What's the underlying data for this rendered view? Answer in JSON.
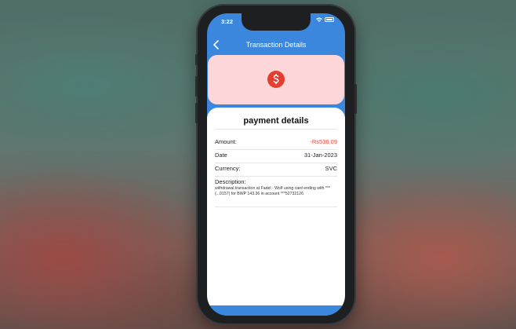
{
  "status_bar": {
    "time": "3:22"
  },
  "nav": {
    "title": "Transaction Details"
  },
  "hero": {
    "background": "#fcd6d8",
    "icon": "dollar-icon",
    "icon_color": "#e53e2f"
  },
  "details": {
    "title": "payment details",
    "amount_label": "Amount:",
    "amount_value": "-Rs536.09",
    "date_label": "Date",
    "date_value": "31-Jan-2023",
    "currency_label": "Currency:",
    "currency_value": "SVC",
    "description_label": "Description:",
    "description_text": "withdrawal transaction at Fadel - Wolf using card ending with ***(...0157) for BWP 143.36 in account ***52732126"
  },
  "colors": {
    "accent": "#3b87dd",
    "negative": "#e54a3a"
  }
}
